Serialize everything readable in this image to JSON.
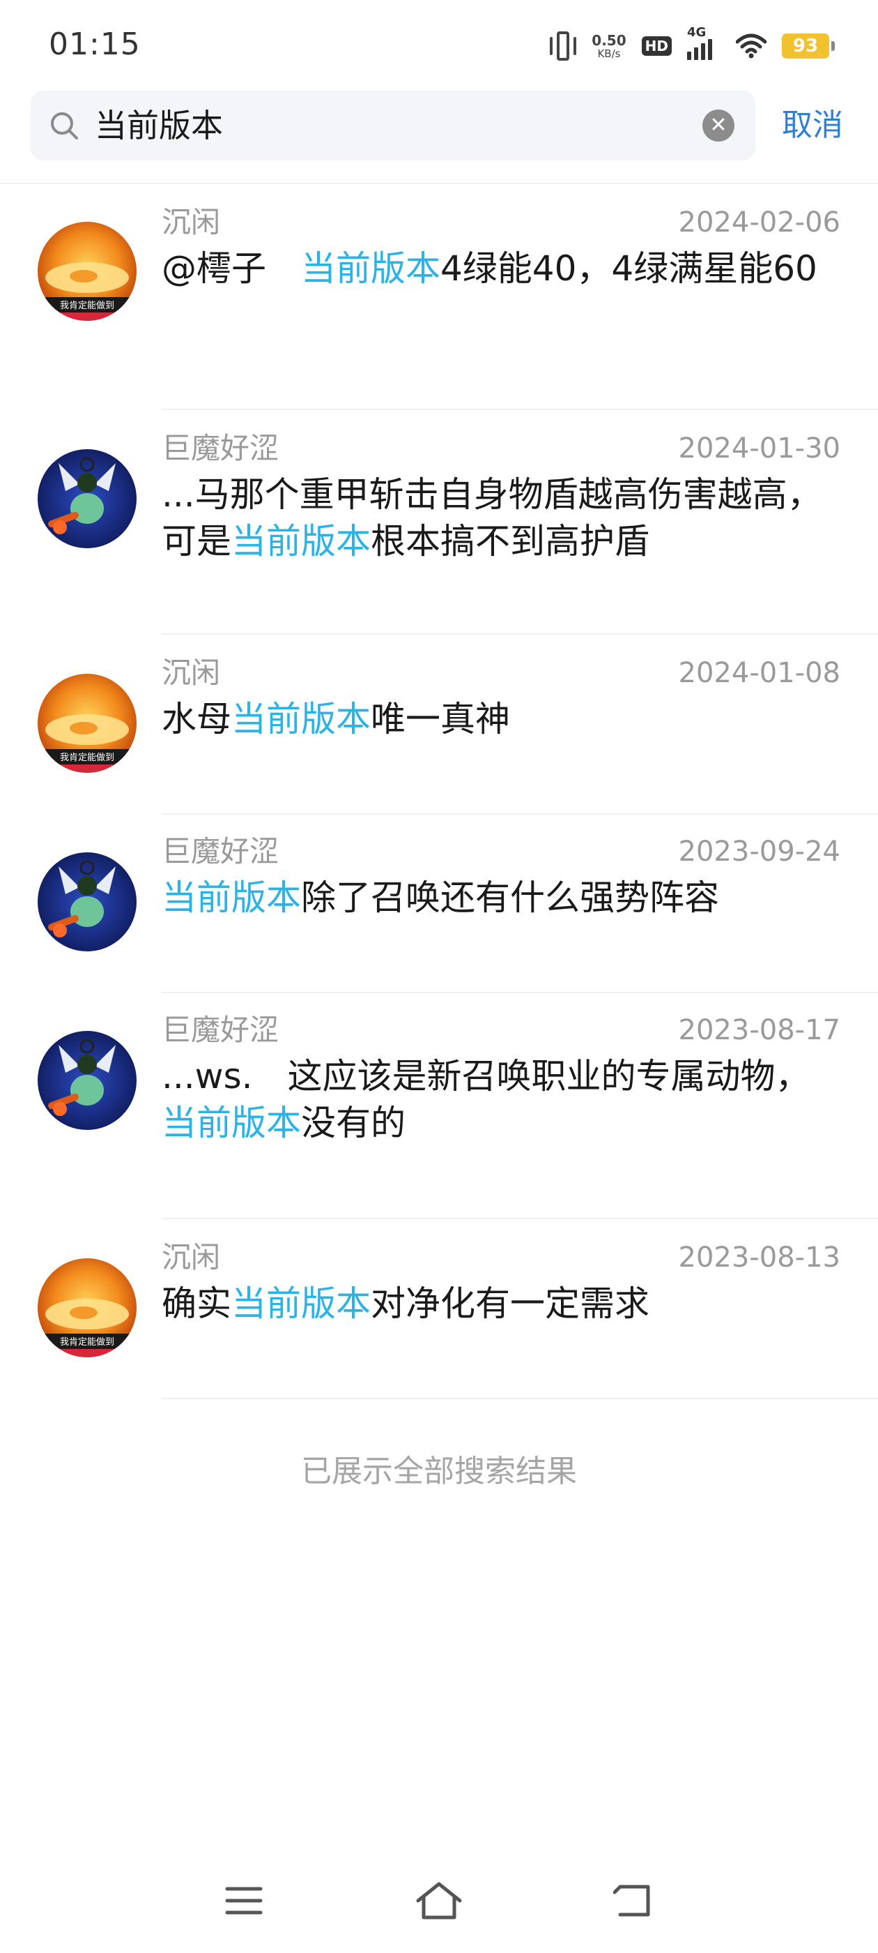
{
  "status_bar": {
    "time": "01:15",
    "net_speed_value": "0.50",
    "net_speed_unit": "KB/s",
    "hd": "HD",
    "network": "4G",
    "battery": "93",
    "icons": [
      "vibrate-icon",
      "hd-icon",
      "signal-icon",
      "wifi-icon",
      "battery-icon"
    ]
  },
  "search": {
    "query": "当前版本",
    "clear_icon": "clear-icon",
    "cancel_label": "取消"
  },
  "highlight_color": "#2bb3e6",
  "results": [
    {
      "author": "沉闲",
      "avatar": "orange",
      "avatar_text": "我肯定能做到",
      "date": "2024-02-06",
      "content_before": "@樗子　",
      "content_highlight": "当前版本",
      "content_after": "4绿能40，4绿满星能60"
    },
    {
      "author": "巨魔好涩",
      "avatar": "blue",
      "date": "2024-01-30",
      "content_before": "...马那个重甲斩击自身物盾越高伤害越高，可是",
      "content_highlight": "当前版本",
      "content_after": "根本搞不到高护盾"
    },
    {
      "author": "沉闲",
      "avatar": "orange",
      "avatar_text": "我肯定能做到",
      "date": "2024-01-08",
      "content_before": "水母",
      "content_highlight": "当前版本",
      "content_after": "唯一真神"
    },
    {
      "author": "巨魔好涩",
      "avatar": "blue",
      "date": "2023-09-24",
      "content_before": "",
      "content_highlight": "当前版本",
      "content_after": "除了召唤还有什么强势阵容"
    },
    {
      "author": "巨魔好涩",
      "avatar": "blue",
      "date": "2023-08-17",
      "content_before": "...ws.　这应该是新召唤职业的专属动物，",
      "content_highlight": "当前版本",
      "content_after": "没有的"
    },
    {
      "author": "沉闲",
      "avatar": "orange",
      "avatar_text": "我肯定能做到",
      "date": "2023-08-13",
      "content_before": "确实",
      "content_highlight": "当前版本",
      "content_after": "对净化有一定需求"
    }
  ],
  "footer_note": "已展示全部搜索结果",
  "nav_bar": {
    "icons": [
      "menu-icon",
      "home-icon",
      "back-icon"
    ]
  }
}
